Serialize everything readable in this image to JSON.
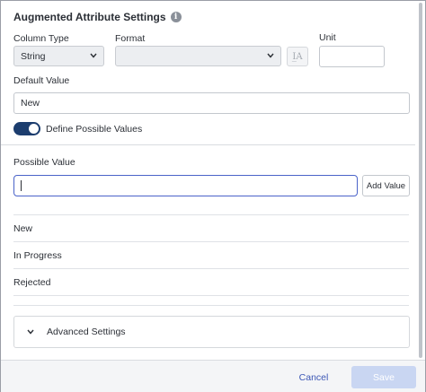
{
  "header": {
    "title": "Augmented Attribute Settings",
    "info_icon": "info-icon"
  },
  "fields": {
    "column_type": {
      "label": "Column Type",
      "value": "String"
    },
    "format": {
      "label": "Format",
      "value": ""
    },
    "unit": {
      "label": "Unit",
      "value": ""
    },
    "default_value": {
      "label": "Default Value",
      "value": "New"
    },
    "define_possible_values": {
      "label": "Define Possible Values",
      "checked": true
    },
    "possible_value": {
      "label": "Possible Value",
      "value": ""
    }
  },
  "add_value_button": "Add Value",
  "possible_values": [
    "New",
    "In Progress",
    "Rejected"
  ],
  "advanced_settings": {
    "label": "Advanced Settings",
    "icon": "chevron-down-icon"
  },
  "footer": {
    "cancel_label": "Cancel",
    "save_label": "Save"
  },
  "colors": {
    "toggle_on": "#1c3d6e",
    "primary_disabled": "#c9d6f2",
    "link": "#3c57b5",
    "focus_border": "#4a63c9"
  }
}
